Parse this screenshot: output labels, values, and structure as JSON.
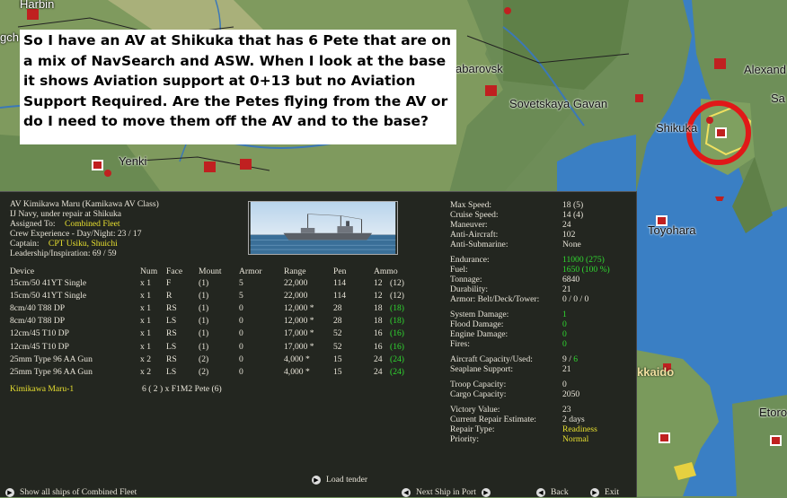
{
  "map": {
    "labels": [
      "Harbin",
      "gch",
      "abarovsk",
      "Alexand",
      "Sa",
      "Sovetskaya Gavan",
      "Shikuka",
      "Yenki",
      "Toyohara",
      "kkaido",
      "Etoro"
    ]
  },
  "note": {
    "text": "So I have an AV at Shikuka that has 6 Pete that are on a mix of NavSearch and ASW.  When I look at the base it shows Aviation support at 0+13 but no Aviation Support Required.  Are the Petes flying from the AV or do I need to move them off the AV and to the base?"
  },
  "ship": {
    "name": "AV Kimikawa Maru (Kamikawa AV Class)",
    "status": "IJ Navy, under repair at Shikuka",
    "assigned_label": "Assigned To:",
    "assigned_value": "Combined Fleet",
    "crew_exp": "Crew Experience - Day/Night: 23 / 17",
    "captain_label": "Captain:",
    "captain_value": "CPT Usiku, Shuichi",
    "leadership": "Leadership/Inspiration: 69 / 59"
  },
  "weapons": {
    "headers": [
      "Device",
      "Num",
      "Face",
      "Mount",
      "Armor",
      "Range",
      "Pen",
      "Ammo"
    ],
    "rows": [
      {
        "device": "15cm/50 41YT Single",
        "num": "x 1",
        "face": "F",
        "mount": "(1)",
        "armor": "5",
        "range": "22,000",
        "pen": "114",
        "ammo": "12",
        "ammo_max": "(12)",
        "ammo_color": "white"
      },
      {
        "device": "15cm/50 41YT Single",
        "num": "x 1",
        "face": "R",
        "mount": "(1)",
        "armor": "5",
        "range": "22,000",
        "pen": "114",
        "ammo": "12",
        "ammo_max": "(12)",
        "ammo_color": "white"
      },
      {
        "device": "8cm/40 T88 DP",
        "num": "x 1",
        "face": "RS",
        "mount": "(1)",
        "armor": "0",
        "range": "12,000 *",
        "pen": "28",
        "ammo": "18",
        "ammo_max": "(18)",
        "ammo_color": "green"
      },
      {
        "device": "8cm/40 T88 DP",
        "num": "x 1",
        "face": "LS",
        "mount": "(1)",
        "armor": "0",
        "range": "12,000 *",
        "pen": "28",
        "ammo": "18",
        "ammo_max": "(18)",
        "ammo_color": "green"
      },
      {
        "device": "12cm/45 T10 DP",
        "num": "x 1",
        "face": "RS",
        "mount": "(1)",
        "armor": "0",
        "range": "17,000 *",
        "pen": "52",
        "ammo": "16",
        "ammo_max": "(16)",
        "ammo_color": "green"
      },
      {
        "device": "12cm/45 T10 DP",
        "num": "x 1",
        "face": "LS",
        "mount": "(1)",
        "armor": "0",
        "range": "17,000 *",
        "pen": "52",
        "ammo": "16",
        "ammo_max": "(16)",
        "ammo_color": "green"
      },
      {
        "device": "25mm Type 96 AA Gun",
        "num": "x 2",
        "face": "RS",
        "mount": "(2)",
        "armor": "0",
        "range": "4,000 *",
        "pen": "15",
        "ammo": "24",
        "ammo_max": "(24)",
        "ammo_color": "green"
      },
      {
        "device": "25mm Type 96 AA Gun",
        "num": "x 2",
        "face": "LS",
        "mount": "(2)",
        "armor": "0",
        "range": "4,000 *",
        "pen": "15",
        "ammo": "24",
        "ammo_max": "(24)",
        "ammo_color": "green"
      }
    ]
  },
  "air_group": {
    "name": "Kimikawa Maru-1",
    "aircraft": "6 ( 2 ) x F1M2 Pete (6)"
  },
  "stats": [
    {
      "label": "Max Speed:",
      "value": "18 (5)",
      "color": "white",
      "gap": 0
    },
    {
      "label": "Cruise Speed:",
      "value": "14 (4)",
      "color": "white",
      "gap": 0
    },
    {
      "label": "Maneuver:",
      "value": "24",
      "color": "white",
      "gap": 0
    },
    {
      "label": "Anti-Aircraft:",
      "value": "102",
      "color": "white",
      "gap": 0
    },
    {
      "label": "Anti-Submarine:",
      "value": "None",
      "color": "white",
      "gap": 0
    },
    {
      "label": "Endurance:",
      "value": "11000 (275)",
      "color": "green",
      "gap": 1
    },
    {
      "label": "Fuel:",
      "value": "1650 (100 %)",
      "color": "green",
      "gap": 0
    },
    {
      "label": "Tonnage:",
      "value": "6840",
      "color": "white",
      "gap": 0
    },
    {
      "label": "Durability:",
      "value": "21",
      "color": "white",
      "gap": 0
    },
    {
      "label": "Armor: Belt/Deck/Tower:",
      "value": "0 / 0 / 0",
      "color": "white",
      "gap": 0
    },
    {
      "label": "System Damage:",
      "value": "1",
      "color": "green",
      "gap": 1
    },
    {
      "label": "Flood Damage:",
      "value": "0",
      "color": "green",
      "gap": 0
    },
    {
      "label": "Engine Damage:",
      "value": "0",
      "color": "green",
      "gap": 0
    },
    {
      "label": "Fires:",
      "value": "0",
      "color": "green",
      "gap": 0
    },
    {
      "label": "Aircraft Capacity/Used:",
      "value": "9 / 6",
      "color": "mixed",
      "gap": 1
    },
    {
      "label": "Seaplane Support:",
      "value": "21",
      "color": "white",
      "gap": 0
    },
    {
      "label": "Troop Capacity:",
      "value": "0",
      "color": "white",
      "gap": 1
    },
    {
      "label": "Cargo Capacity:",
      "value": "2050",
      "color": "white",
      "gap": 0
    },
    {
      "label": "Victory Value:",
      "value": "23",
      "color": "white",
      "gap": 1
    },
    {
      "label": "Current Repair Estimate:",
      "value": "2 days",
      "color": "white",
      "gap": 0
    },
    {
      "label": "Repair Type:",
      "value": "Readiness",
      "color": "yellow",
      "gap": 0
    },
    {
      "label": "Priority:",
      "value": "Normal",
      "color": "yellow",
      "gap": 0
    }
  ],
  "aircraft_capacity_parts": {
    "cap": "9",
    "sep": " / ",
    "used": "6"
  },
  "buttons": {
    "load_tender": "Load tender",
    "show_all": "Show all ships of Combined Fleet",
    "next_ship": "Next Ship in Port",
    "back": "Back",
    "exit": "Exit"
  },
  "colors": {
    "panel_bg": "#232620",
    "yellow": "#e8e030",
    "green": "#30d830",
    "highlight_circle": "#e01818"
  }
}
